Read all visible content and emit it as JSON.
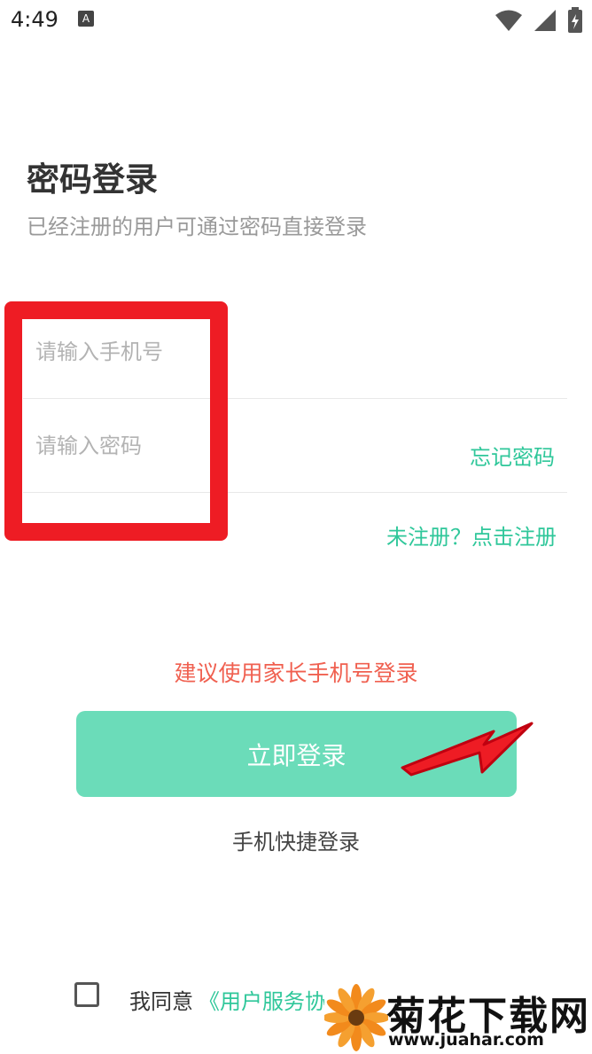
{
  "status_bar": {
    "time": "4:49",
    "notification_icon_letter": "A",
    "icons": [
      "wifi-icon",
      "signal-icon",
      "battery-icon"
    ]
  },
  "header": {
    "title": "密码登录",
    "subtitle": "已经注册的用户可通过密码直接登录"
  },
  "form": {
    "phone_placeholder": "请输入手机号",
    "password_placeholder": "请输入密码",
    "forgot_password": "忘记密码",
    "register_link": "未注册？点击注册"
  },
  "hint": "建议使用家长手机号登录",
  "login_button": "立即登录",
  "quick_login": "手机快捷登录",
  "agreement": {
    "text": "我同意",
    "link": "《用户服务协"
  },
  "watermark": {
    "title": "菊花下载网",
    "url": "www.juahar.com"
  },
  "colors": {
    "accent": "#2fc79a",
    "button": "#6bdcb9",
    "hint": "#f06050",
    "annotation": "#ee1c24"
  }
}
